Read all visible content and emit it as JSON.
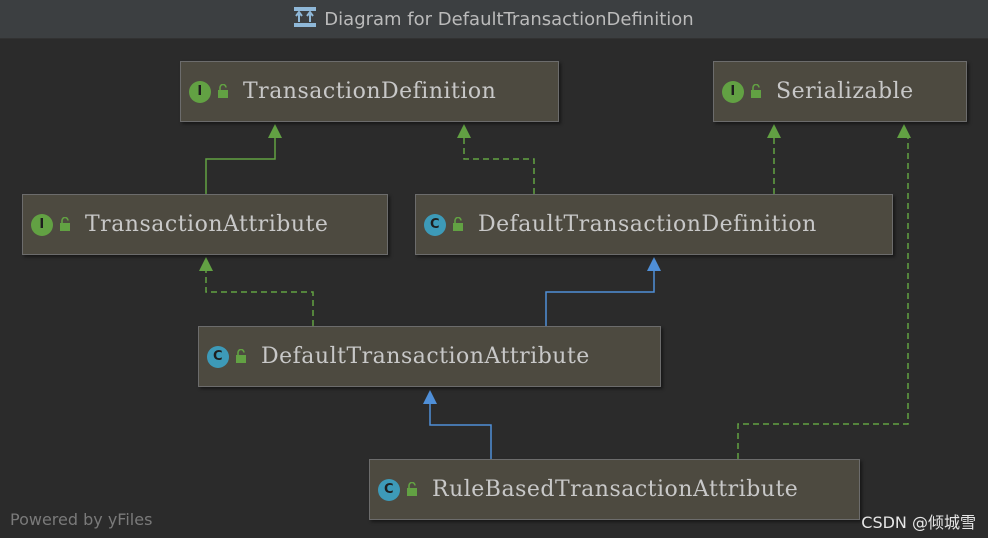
{
  "window": {
    "title": "Diagram for DefaultTransactionDefinition"
  },
  "colors": {
    "interface_badge": "#62a143",
    "class_badge": "#3d9ab8",
    "implements_edge": "#62a143",
    "extends_edge": "#4f8fd8",
    "node_fill": "#4d4a40"
  },
  "nodes": [
    {
      "id": "TransactionDefinition",
      "label": "TransactionDefinition",
      "kind": "I",
      "kind_type": "interface"
    },
    {
      "id": "Serializable",
      "label": "Serializable",
      "kind": "I",
      "kind_type": "interface"
    },
    {
      "id": "TransactionAttribute",
      "label": "TransactionAttribute",
      "kind": "I",
      "kind_type": "interface"
    },
    {
      "id": "DefaultTransactionDefinition",
      "label": "DefaultTransactionDefinition",
      "kind": "C",
      "kind_type": "class"
    },
    {
      "id": "DefaultTransactionAttribute",
      "label": "DefaultTransactionAttribute",
      "kind": "C",
      "kind_type": "class"
    },
    {
      "id": "RuleBasedTransactionAttribute",
      "label": "RuleBasedTransactionAttribute",
      "kind": "C",
      "kind_type": "class"
    }
  ],
  "edges": [
    {
      "from": "TransactionAttribute",
      "to": "TransactionDefinition",
      "relation": "extends-interface"
    },
    {
      "from": "DefaultTransactionDefinition",
      "to": "TransactionDefinition",
      "relation": "implements"
    },
    {
      "from": "DefaultTransactionDefinition",
      "to": "Serializable",
      "relation": "implements"
    },
    {
      "from": "DefaultTransactionAttribute",
      "to": "TransactionAttribute",
      "relation": "implements"
    },
    {
      "from": "DefaultTransactionAttribute",
      "to": "DefaultTransactionDefinition",
      "relation": "extends"
    },
    {
      "from": "RuleBasedTransactionAttribute",
      "to": "DefaultTransactionAttribute",
      "relation": "extends"
    },
    {
      "from": "RuleBasedTransactionAttribute",
      "to": "Serializable",
      "relation": "implements"
    }
  ],
  "footer": {
    "powered_by": "Powered by yFiles",
    "watermark": "CSDN @倾城雪"
  }
}
